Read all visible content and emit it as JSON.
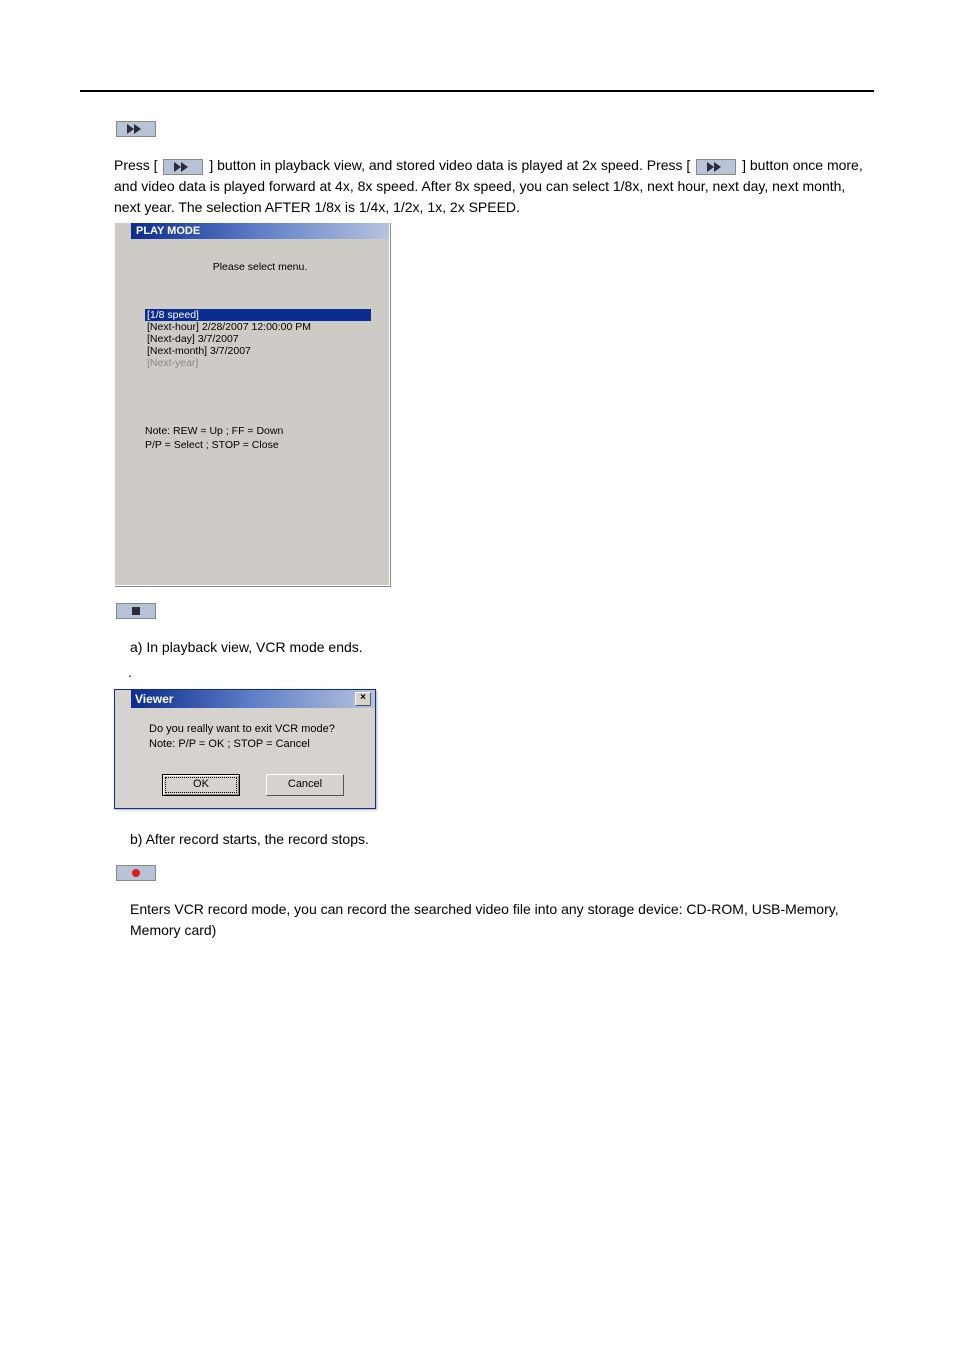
{
  "section_ff": {
    "text_before_btn1": "Press [",
    "text_between": "] button in playback view, and stored video data is played at 2x speed. Press [",
    "text_after_btn2": "] button once more, and video data is played forward at 4x, 8x speed. After 8x speed, you can select 1/8x, next hour, next day, next month, next year. The selection AFTER 1/8x is 1/4x, 1/2x, 1x, 2x SPEED."
  },
  "playmode": {
    "title": "PLAY MODE",
    "prompt": "Please select menu.",
    "items": [
      {
        "label": "[1/8 speed]",
        "selected": true,
        "dim": false
      },
      {
        "label": "[Next-hour] 2/28/2007 12:00:00 PM",
        "selected": false,
        "dim": false
      },
      {
        "label": "[Next-day] 3/7/2007",
        "selected": false,
        "dim": false
      },
      {
        "label": "[Next-month] 3/7/2007",
        "selected": false,
        "dim": false
      },
      {
        "label": "[Next-year]",
        "selected": false,
        "dim": true
      }
    ],
    "note_line1": "Note: REW = Up ; FF = Down",
    "note_line2": "P/P = Select ; STOP = Close"
  },
  "section_stop": {
    "line_a": "a) In playback view, VCR mode ends.",
    "dot": ".",
    "line_b": "b) After record starts, the record stops."
  },
  "viewer": {
    "title": "Viewer",
    "close_glyph": "×",
    "msg_line1": "Do you really want to exit VCR mode?",
    "msg_line2": "Note: P/P = OK ; STOP = Cancel",
    "ok_label": "OK",
    "cancel_label": "Cancel"
  },
  "section_rec": {
    "text": "Enters VCR record mode, you can record the searched video file into any storage device: CD-ROM, USB-Memory, Memory card)"
  }
}
